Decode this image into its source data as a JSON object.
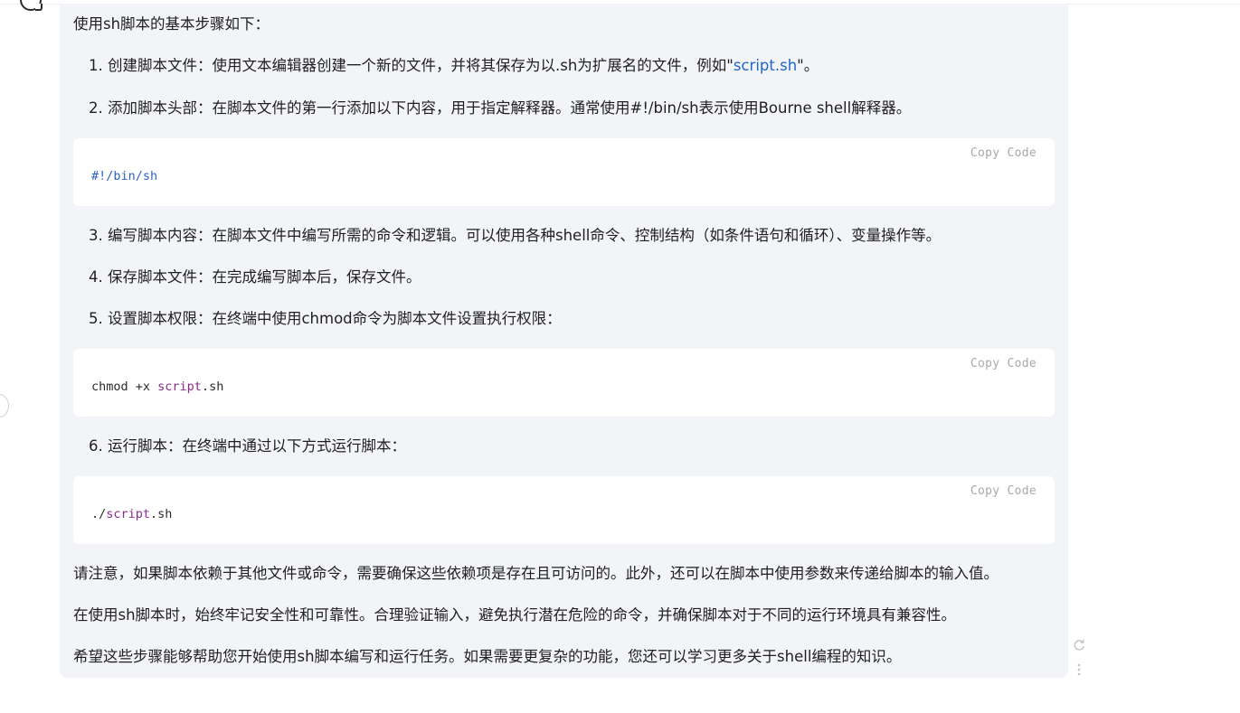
{
  "intro": "使用sh脚本的基本步骤如下：",
  "steps": [
    {
      "prefix": "1. 创建脚本文件：使用文本编辑器创建一个新的文件，并将其保存为以.sh为扩展名的文件，例如\"",
      "link": "script.sh",
      "suffix": "\"。"
    },
    {
      "text": "2. 添加脚本头部：在脚本文件的第一行添加以下内容，用于指定解释器。通常使用#!/bin/sh表示使用Bourne shell解释器。"
    },
    {
      "text": "3. 编写脚本内容：在脚本文件中编写所需的命令和逻辑。可以使用各种shell命令、控制结构（如条件语句和循环）、变量操作等。"
    },
    {
      "text": "4. 保存脚本文件：在完成编写脚本后，保存文件。"
    },
    {
      "text": "5. 设置脚本权限：在终端中使用chmod命令为脚本文件设置执行权限："
    },
    {
      "text": "6. 运行脚本：在终端中通过以下方式运行脚本："
    }
  ],
  "code_blocks": [
    {
      "copy_label": "Copy Code",
      "tokens": [
        {
          "text": "#!/bin/sh",
          "kind": "blue"
        }
      ]
    },
    {
      "copy_label": "Copy Code",
      "tokens": [
        {
          "text": "chmod +x ",
          "kind": "plain"
        },
        {
          "text": "script",
          "kind": "purple"
        },
        {
          "text": ".sh",
          "kind": "plain"
        }
      ]
    },
    {
      "copy_label": "Copy Code",
      "tokens": [
        {
          "text": "./",
          "kind": "plain"
        },
        {
          "text": "script",
          "kind": "purple"
        },
        {
          "text": ".sh",
          "kind": "plain"
        }
      ]
    }
  ],
  "notes": [
    "请注意，如果脚本依赖于其他文件或命令，需要确保这些依赖项是存在且可访问的。此外，还可以在脚本中使用参数来传递给脚本的输入值。",
    "在使用sh脚本时，始终牢记安全性和可靠性。合理验证输入，避免执行潜在危险的命令，并确保脚本对于不同的运行环境具有兼容性。",
    "希望这些步骤能够帮助您开始使用sh脚本编写和运行任务。如果需要更复杂的功能，您还可以学习更多关于shell编程的知识。"
  ],
  "colors": {
    "bubble_bg": "#f3f4f7",
    "code_bg": "#ffffff",
    "link": "#1f65c9",
    "token_blue": "#2e63c7",
    "token_purple": "#8b2a8f",
    "copy_label": "#a9a9a9"
  },
  "icons": {
    "assistant_avatar": "assistant-avatar-icon",
    "regenerate": "refresh-icon",
    "more_options": "more-vertical-icon"
  }
}
